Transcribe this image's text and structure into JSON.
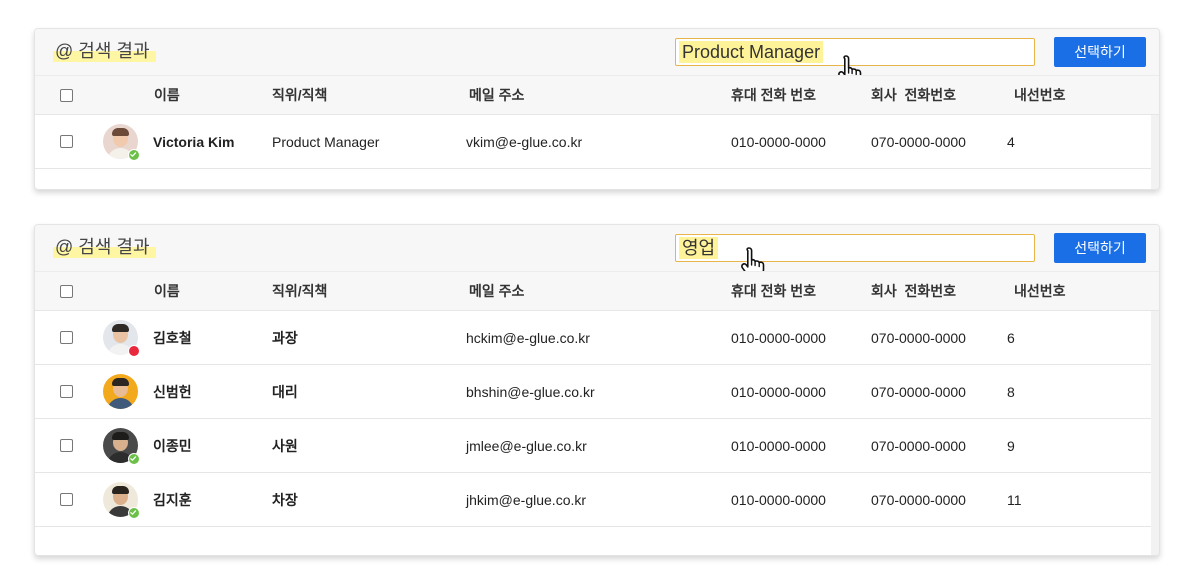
{
  "panels": [
    {
      "title": "@ 검색 결과",
      "search_value": "Product Manager",
      "select_label": "선택하기",
      "columns": {
        "name": "이름",
        "position": "직위/직책",
        "email": "메일 주소",
        "mobile": "휴대 전화 번호",
        "office": "회사  전화번호",
        "ext": "내선번호"
      },
      "rows": [
        {
          "name": "Victoria Kim",
          "position": "Product Manager",
          "email": "vkim@e-glue.co.kr",
          "mobile": "010-0000-0000",
          "office": "070-0000-0000",
          "ext": "4",
          "status": "online",
          "avatar": {
            "bg": "#e9d6cf",
            "skin": "#f1c9ad",
            "hair": "#6b4a3a",
            "shirt": "#f4f0ea"
          }
        }
      ]
    },
    {
      "title": "@ 검색 결과",
      "search_value": "영업",
      "select_label": "선택하기",
      "columns": {
        "name": "이름",
        "position": "직위/직책",
        "email": "메일 주소",
        "mobile": "휴대 전화 번호",
        "office": "회사  전화번호",
        "ext": "내선번호"
      },
      "rows": [
        {
          "name": "김호철",
          "position": "과장",
          "email": "hckim@e-glue.co.kr",
          "mobile": "010-0000-0000",
          "office": "070-0000-0000",
          "ext": "6",
          "status": "busy",
          "avatar": {
            "bg": "#e3e6ea",
            "skin": "#e9c3a3",
            "hair": "#2f2a26",
            "shirt": "#f2f2f2"
          }
        },
        {
          "name": "신범헌",
          "position": "대리",
          "email": "bhshin@e-glue.co.kr",
          "mobile": "010-0000-0000",
          "office": "070-0000-0000",
          "ext": "8",
          "status": "",
          "avatar": {
            "bg": "#f2a91e",
            "skin": "#e8bc95",
            "hair": "#2b2622",
            "shirt": "#3f5a7a"
          }
        },
        {
          "name": "이종민",
          "position": "사원",
          "email": "jmlee@e-glue.co.kr",
          "mobile": "010-0000-0000",
          "office": "070-0000-0000",
          "ext": "9",
          "status": "online",
          "avatar": {
            "bg": "#4a4a4a",
            "skin": "#d8b08e",
            "hair": "#1e1c1b",
            "shirt": "#2d2d2d"
          }
        },
        {
          "name": "김지훈",
          "position": "차장",
          "email": "jhkim@e-glue.co.kr",
          "mobile": "010-0000-0000",
          "office": "070-0000-0000",
          "ext": "11",
          "status": "online",
          "avatar": {
            "bg": "#efe9dc",
            "skin": "#dcb08a",
            "hair": "#2a241f",
            "shirt": "#3a3a3a"
          }
        }
      ]
    }
  ],
  "colors": {
    "accent": "#1a6fe6",
    "highlight": "#fff39a",
    "search_border": "#e8b54a",
    "status_online": "#6cc04a",
    "status_busy": "#e8283c",
    "status_offline": "#ffffff"
  },
  "icons": {
    "cursor": "hand-pointer-icon",
    "status_online": "check-circle-icon",
    "status_busy": "red-dot-icon",
    "status_offline": "x-circle-icon"
  }
}
